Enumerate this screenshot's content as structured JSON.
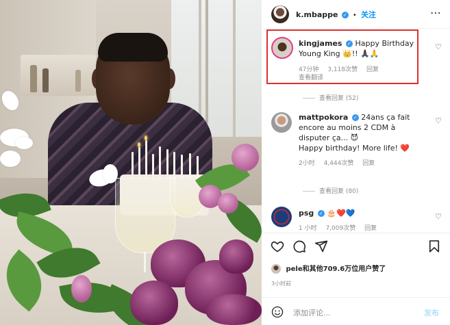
{
  "post": {
    "author": "k.mbappe",
    "follow_label": "关注",
    "separator": "•"
  },
  "comments": [
    {
      "user": "kingjames",
      "text": "Happy Birthday Young King 👑!! 🙏🏿🙏",
      "time": "47分钟",
      "likes": "3,118次赞",
      "reply": "回复",
      "translate": "查看翻译",
      "view_replies": "查看回复 (52)"
    },
    {
      "user": "mattpokora",
      "text": "24ans ça fait encore au moins 2 CDM à disputer ça... 😈",
      "text2": "Happy birthday! More life! ❤️",
      "time": "2小时",
      "likes": "4,444次赞",
      "reply": "回复",
      "view_replies": "查看回复 (80)"
    },
    {
      "user": "psg",
      "text": "🎂❤️💙",
      "time": "1 小时",
      "likes": "7,009次赞",
      "reply": "回复"
    }
  ],
  "likes_summary": "pele和其他709.6万位用户赞了",
  "posted_ago": "3小时前",
  "add_comment": {
    "placeholder": "添加评论...",
    "post_label": "发布"
  },
  "colors": {
    "highlight_border": "#d9302c",
    "link_blue": "#0095f6",
    "verified_blue": "#3897f0"
  },
  "icons": [
    "heart-icon",
    "comment-icon",
    "share-icon",
    "bookmark-icon",
    "emoji-icon",
    "more-icon",
    "verified-icon"
  ]
}
